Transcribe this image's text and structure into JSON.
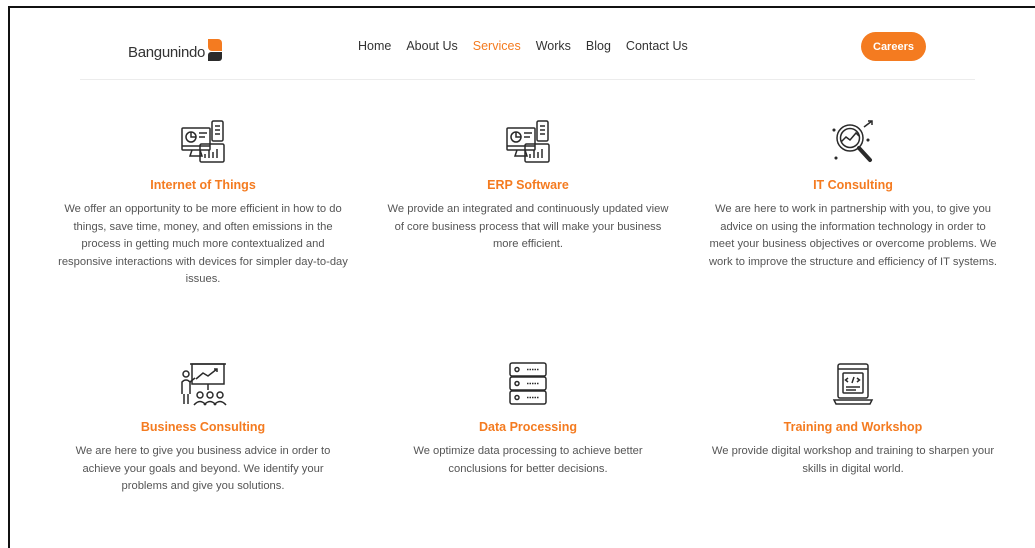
{
  "header": {
    "logo_text": "Bangunindo",
    "nav": [
      "Home",
      "About Us",
      "Services",
      "Works",
      "Blog",
      "Contact Us"
    ],
    "active_nav": "Services",
    "careers_label": "Careers"
  },
  "services": [
    {
      "icon": "iot-devices-icon",
      "title": "Internet of Things",
      "description": "We offer an opportunity to be more efficient in how to do things, save time, money, and often emissions in the process in getting much more contextualized and responsive interactions with devices for simpler day-to-day issues."
    },
    {
      "icon": "erp-devices-icon",
      "title": "ERP Software",
      "description": "We provide an integrated and continuously updated view of core business process that will make your business more efficient."
    },
    {
      "icon": "analytics-magnifier-icon",
      "title": "IT Consulting",
      "description": "We are here to work in partnership with you, to give you advice on using the information technology in order to meet your business objectives or overcome problems. We work to improve the structure and efficiency of IT systems."
    },
    {
      "icon": "presentation-icon",
      "title": "Business Consulting",
      "description": "We are here to give you business advice in order to achieve your goals and beyond. We identify your problems and give you solutions."
    },
    {
      "icon": "server-stack-icon",
      "title": "Data Processing",
      "description": "We optimize data processing to achieve better conclusions for better decisions."
    },
    {
      "icon": "code-laptop-icon",
      "title": "Training and Workshop",
      "description": "We provide digital workshop and training to sharpen your skills in digital world."
    }
  ],
  "colors": {
    "accent": "#f47b20",
    "text": "#555555",
    "nav_text": "#333333"
  }
}
